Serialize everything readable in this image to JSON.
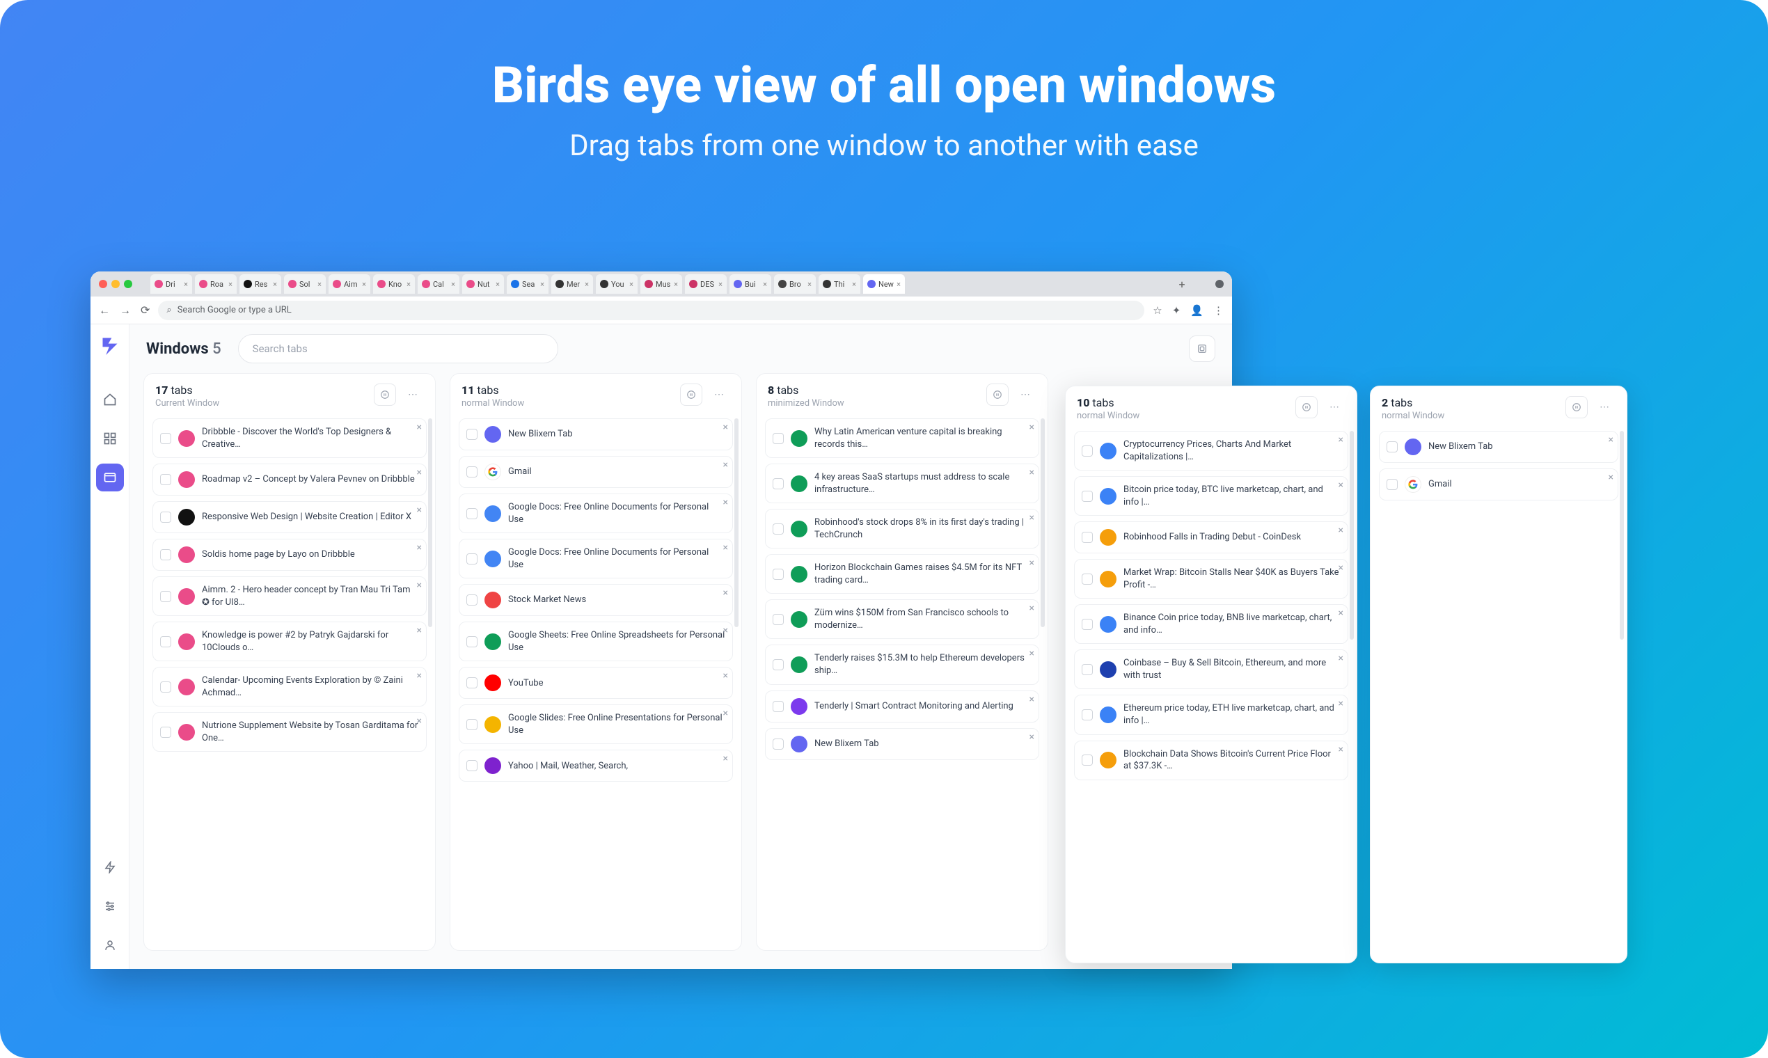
{
  "headline": {
    "title": "Birds eye view of all open windows",
    "subtitle": "Drag tabs from one window to another with ease"
  },
  "browser": {
    "tabs": [
      {
        "label": "Dri",
        "color": "#ea4c89"
      },
      {
        "label": "Roa",
        "color": "#ea4c89"
      },
      {
        "label": "Res",
        "color": "#111"
      },
      {
        "label": "Sol",
        "color": "#ea4c89"
      },
      {
        "label": "Aim",
        "color": "#ea4c89"
      },
      {
        "label": "Kno",
        "color": "#ea4c89"
      },
      {
        "label": "Cal",
        "color": "#ea4c89"
      },
      {
        "label": "Nut",
        "color": "#ea4c89"
      },
      {
        "label": "Sea",
        "color": "#1a73e8"
      },
      {
        "label": "Mer",
        "color": "#333"
      },
      {
        "label": "You",
        "color": "#333"
      },
      {
        "label": "Mus",
        "color": "#cc3366"
      },
      {
        "label": "DES",
        "color": "#cc3366"
      },
      {
        "label": "Bui",
        "color": "#6366f1"
      },
      {
        "label": "Bro",
        "color": "#444"
      },
      {
        "label": "Thi",
        "color": "#333"
      },
      {
        "label": "New",
        "color": "#6366f1",
        "active": true
      }
    ],
    "url_placeholder": "Search Google or type a URL"
  },
  "app": {
    "title_label": "Windows",
    "window_count": "5",
    "search_placeholder": "Search tabs"
  },
  "columns": [
    {
      "count": "17",
      "tabs_word": "tabs",
      "sub": "Current Window",
      "items": [
        {
          "fav": "#ea4c89",
          "txt": "Dribbble - Discover the World's Top Designers & Creative…"
        },
        {
          "fav": "#ea4c89",
          "txt": "Roadmap v2 – Concept by Valera Pevnev on Dribbble"
        },
        {
          "fav": "#111",
          "txt": "Responsive Web Design | Website Creation | Editor X"
        },
        {
          "fav": "#ea4c89",
          "txt": "Soldis home page by Layo on Dribbble"
        },
        {
          "fav": "#ea4c89",
          "txt": "Aimm. 2 - Hero header concept by Tran Mau Tri Tam ✪ for UI8…"
        },
        {
          "fav": "#ea4c89",
          "txt": "Knowledge is power #2 by Patryk Gajdarski for 10Clouds o…"
        },
        {
          "fav": "#ea4c89",
          "txt": "Calendar- Upcoming Events Exploration by © Zaini Achmad…"
        },
        {
          "fav": "#ea4c89",
          "txt": "Nutrione Supplement Website by Tosan Garditama for One…"
        }
      ]
    },
    {
      "count": "11",
      "tabs_word": "tabs",
      "sub": "normal Window",
      "items": [
        {
          "fav": "#6366f1",
          "txt": "New Blixem Tab"
        },
        {
          "fav": "google",
          "txt": "Gmail"
        },
        {
          "fav": "#4285f4",
          "txt": "Google Docs: Free Online Documents for Personal Use"
        },
        {
          "fav": "#4285f4",
          "txt": "Google Docs: Free Online Documents for Personal Use"
        },
        {
          "fav": "#ef4444",
          "txt": "Stock Market News"
        },
        {
          "fav": "#0f9d58",
          "txt": "Google Sheets: Free Online Spreadsheets for Personal Use"
        },
        {
          "fav": "#ff0000",
          "txt": "YouTube"
        },
        {
          "fav": "#f4b400",
          "txt": "Google Slides: Free Online Presentations for Personal Use"
        },
        {
          "fav": "#7e22ce",
          "txt": "Yahoo | Mail, Weather, Search,"
        }
      ]
    },
    {
      "count": "8",
      "tabs_word": "tabs",
      "sub": "minimized Window",
      "items": [
        {
          "fav": "#0f9d58",
          "txt": "Why Latin American venture capital is breaking records this…"
        },
        {
          "fav": "#0f9d58",
          "txt": "4 key areas SaaS startups must address to scale infrastructure…"
        },
        {
          "fav": "#0f9d58",
          "txt": "Robinhood's stock drops 8% in its first day's trading | TechCrunch"
        },
        {
          "fav": "#0f9d58",
          "txt": "Horizon Blockchain Games raises $4.5M for its NFT trading card…"
        },
        {
          "fav": "#0f9d58",
          "txt": "Züm wins $150M from San Francisco schools to modernize…"
        },
        {
          "fav": "#0f9d58",
          "txt": "Tenderly raises $15.3M to help Ethereum developers ship…"
        },
        {
          "fav": "#7c3aed",
          "txt": "Tenderly | Smart Contract Monitoring and Alerting"
        },
        {
          "fav": "#6366f1",
          "txt": "New Blixem Tab"
        }
      ]
    },
    {
      "count": "10",
      "tabs_word": "tabs",
      "sub": "normal Window",
      "items": [
        {
          "fav": "#3b82f6",
          "txt": "Cryptocurrency Prices, Charts And Market Capitalizations |…"
        },
        {
          "fav": "#3b82f6",
          "txt": "Bitcoin price today, BTC live marketcap, chart, and info |…"
        },
        {
          "fav": "#f59e0b",
          "txt": "Robinhood Falls in Trading Debut - CoinDesk"
        },
        {
          "fav": "#f59e0b",
          "txt": "Market Wrap: Bitcoin Stalls Near $40K as Buyers Take Profit -…"
        },
        {
          "fav": "#3b82f6",
          "txt": "Binance Coin price today, BNB live marketcap, chart, and info…"
        },
        {
          "fav": "#1e40af",
          "txt": "Coinbase – Buy & Sell Bitcoin, Ethereum, and more with trust"
        },
        {
          "fav": "#3b82f6",
          "txt": "Ethereum price today, ETH live marketcap, chart, and info |…"
        },
        {
          "fav": "#f59e0b",
          "txt": "Blockchain Data Shows Bitcoin's Current Price Floor at $37.3K -…"
        }
      ]
    },
    {
      "count": "2",
      "tabs_word": "tabs",
      "sub": "normal Window",
      "items": [
        {
          "fav": "#6366f1",
          "txt": "New Blixem Tab"
        },
        {
          "fav": "google",
          "txt": "Gmail"
        }
      ]
    }
  ]
}
